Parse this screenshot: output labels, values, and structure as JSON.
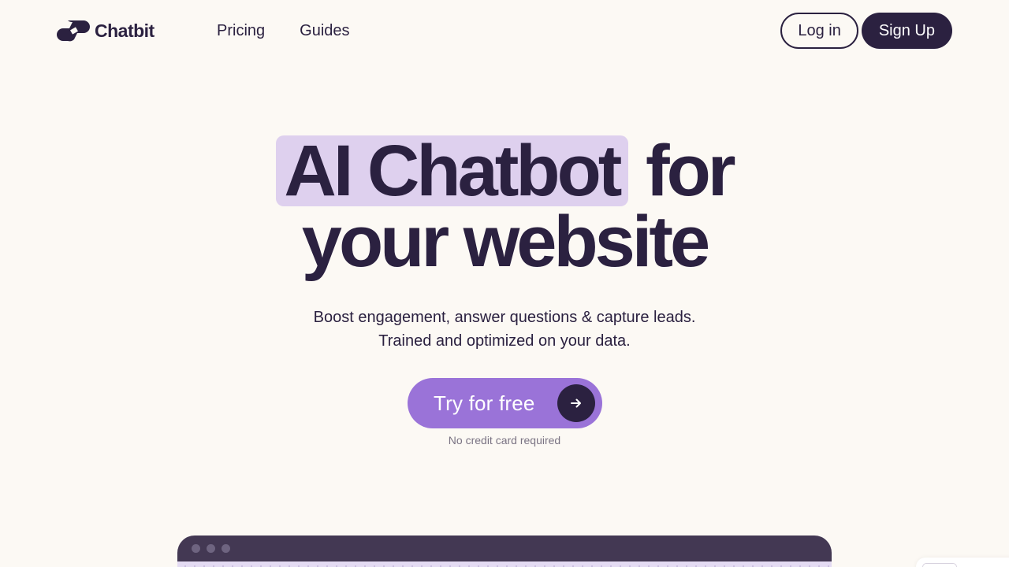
{
  "brand": {
    "name": "Chatbit",
    "logo_icon": "chatbit-logo-icon"
  },
  "nav": {
    "items": [
      {
        "label": "Pricing"
      },
      {
        "label": "Guides"
      }
    ]
  },
  "auth": {
    "login_label": "Log in",
    "signup_label": "Sign Up"
  },
  "hero": {
    "title_highlight": "AI Chatbot",
    "title_rest": "for",
    "title_line2": "your website",
    "subtitle": "Boost engagement, answer questions & capture leads. Trained and optimized on your data.",
    "cta_label": "Try for free",
    "cta_icon": "arrow-right-icon",
    "note": "No credit card required"
  },
  "colors": {
    "background": "#fcf9f4",
    "ink": "#2b2140",
    "accent": "#9a73d8",
    "highlight": "#ded0ee",
    "preview_bar": "#433853"
  }
}
